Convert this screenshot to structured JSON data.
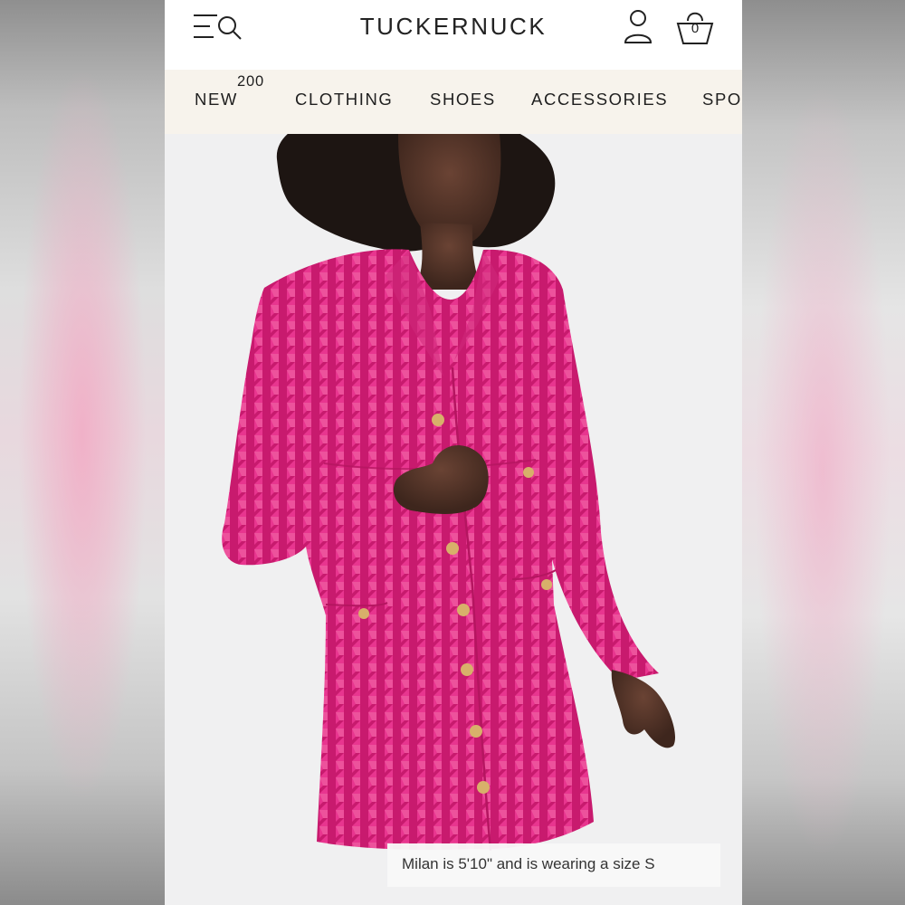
{
  "header": {
    "logo": "TUCKERNUCK",
    "bag_count": "0",
    "icons": [
      "menu-search-icon",
      "account-icon",
      "bag-icon"
    ]
  },
  "nav": {
    "items": [
      {
        "label": "NEW",
        "badge": "200"
      },
      {
        "label": "CLOTHING"
      },
      {
        "label": "SHOES"
      },
      {
        "label": "ACCESSORIES"
      },
      {
        "label": "SPO"
      }
    ]
  },
  "product": {
    "caption": "Milan is 5'10\" and is wearing a size S",
    "colors": {
      "dress_base": "#e8358f",
      "dress_dark": "#c81a6e",
      "dress_light": "#f06aa8",
      "button_gold": "#d8b06a"
    }
  }
}
